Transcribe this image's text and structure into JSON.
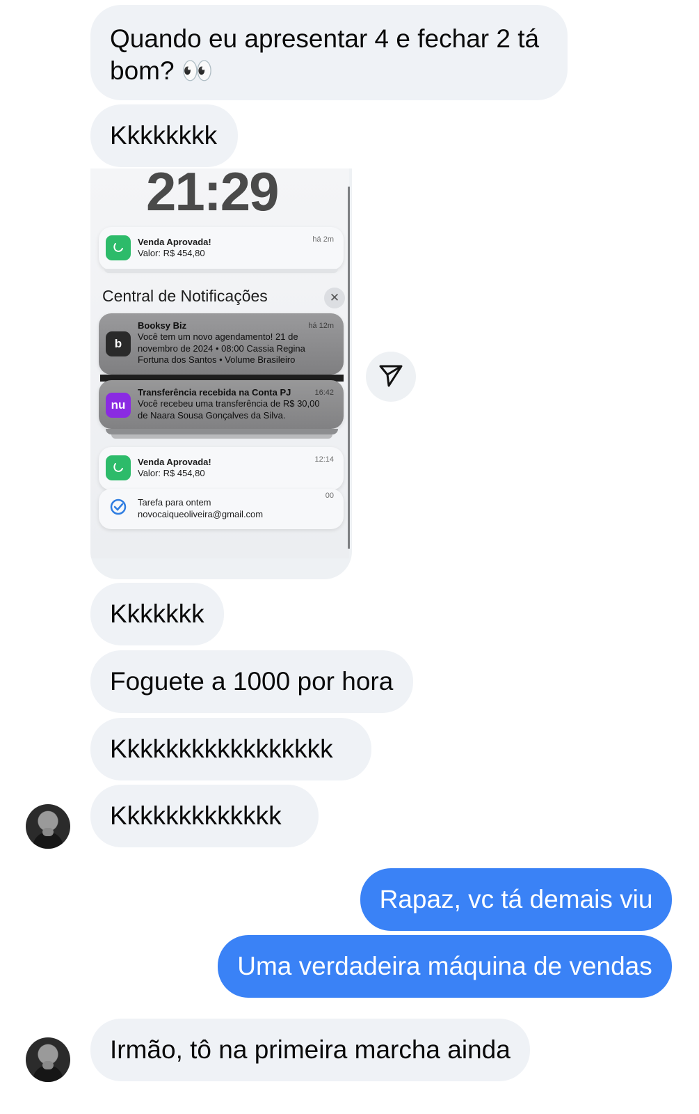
{
  "messages": {
    "m1_line1": "Quando eu apresentar 4 e fechar 2 tá",
    "m1_line2": "bom? 👀",
    "m2": "Kkkkkkkk",
    "m3": "Kkkkkkk",
    "m4": "Foguete a 1000 por hora",
    "m5": "Kkkkkkkkkkkkkkkkk",
    "m6": "Kkkkkkkkkkkkk",
    "m7": "Rapaz, vc tá demais viu",
    "m8": "Uma verdadeira máquina de vendas",
    "m9": "Irmão, tô na primeira marcha ainda"
  },
  "shot": {
    "clock": "21:29",
    "notif1": {
      "title": "Venda Aprovada!",
      "body": "Valor: R$ 454,80",
      "time": "há 2m"
    },
    "center_title": "Central de Notificações",
    "close_glyph": "✕",
    "booksy": {
      "title": "Booksy Biz",
      "line1": "Você tem um novo agendamento! 21 de",
      "line2": "novembro de 2024 • 08:00 Cassia Regina",
      "line3": "Fortuna dos Santos • Volume Brasileiro",
      "time": "há 12m",
      "icon_text": "b"
    },
    "nubank": {
      "title": "Transferência recebida na Conta PJ",
      "line1": "Você recebeu uma transferência de R$ 30,00",
      "line2": "de Naara Sousa Gonçalves da Silva.",
      "time": "16:42",
      "icon_text": "nu"
    },
    "notif4": {
      "title": "Venda Aprovada!",
      "body": "Valor: R$ 454,80",
      "time": "12:14"
    },
    "task": {
      "line1": "Tarefa para ontem",
      "line2": "novocaiqueoliveira@gmail.com",
      "time_partial": "00"
    }
  },
  "icons": {
    "avatar": "person-photo",
    "send": "paper-plane-icon",
    "sale_app": "green-app-icon",
    "booksy_app": "booksy-icon",
    "nubank_app": "nubank-icon",
    "task_app": "check-circle-icon"
  },
  "colors": {
    "incoming_bubble": "#eff2f6",
    "outgoing_bubble": "#3a82f6",
    "nubank_purple": "#8a2be2",
    "sale_green": "#2dbb6a"
  }
}
